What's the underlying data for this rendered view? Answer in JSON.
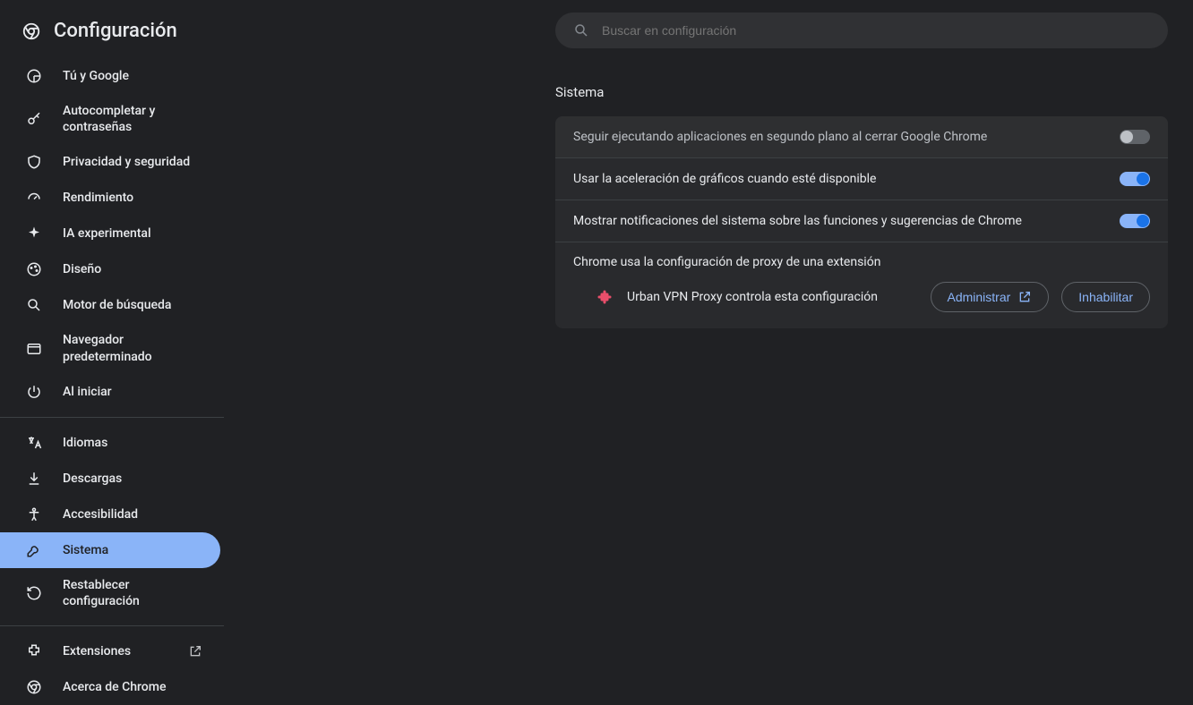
{
  "header": {
    "title": "Configuración"
  },
  "search": {
    "placeholder": "Buscar en configuración"
  },
  "sidebar": {
    "groups": [
      [
        {
          "label": "Tú y Google",
          "icon": "google"
        },
        {
          "label": "Autocompletar y contraseñas",
          "icon": "key"
        },
        {
          "label": "Privacidad y seguridad",
          "icon": "shield"
        },
        {
          "label": "Rendimiento",
          "icon": "speed"
        },
        {
          "label": "IA experimental",
          "icon": "sparkle"
        },
        {
          "label": "Diseño",
          "icon": "palette"
        },
        {
          "label": "Motor de búsqueda",
          "icon": "search"
        },
        {
          "label": "Navegador predeterminado",
          "icon": "window"
        },
        {
          "label": "Al iniciar",
          "icon": "power"
        }
      ],
      [
        {
          "label": "Idiomas",
          "icon": "translate"
        },
        {
          "label": "Descargas",
          "icon": "download"
        },
        {
          "label": "Accesibilidad",
          "icon": "accessibility"
        },
        {
          "label": "Sistema",
          "icon": "wrench",
          "active": true
        },
        {
          "label": "Restablecer configuración",
          "icon": "restore"
        }
      ],
      [
        {
          "label": "Extensiones",
          "icon": "extension",
          "external": true
        },
        {
          "label": "Acerca de Chrome",
          "icon": "chrome"
        }
      ]
    ]
  },
  "main": {
    "section_title": "Sistema",
    "rows": [
      {
        "label": "Seguir ejecutando aplicaciones en segundo plano al cerrar Google Chrome",
        "toggle": false,
        "disabled": true
      },
      {
        "label": "Usar la aceleración de gráficos cuando esté disponible",
        "toggle": true
      },
      {
        "label": "Mostrar notificaciones del sistema sobre las funciones y sugerencias de Chrome",
        "toggle": true
      }
    ],
    "proxy": {
      "label": "Chrome usa la configuración de proxy de una extensión",
      "extension_name": "Urban VPN Proxy controla esta configuración",
      "manage_label": "Administrar",
      "disable_label": "Inhabilitar"
    }
  }
}
